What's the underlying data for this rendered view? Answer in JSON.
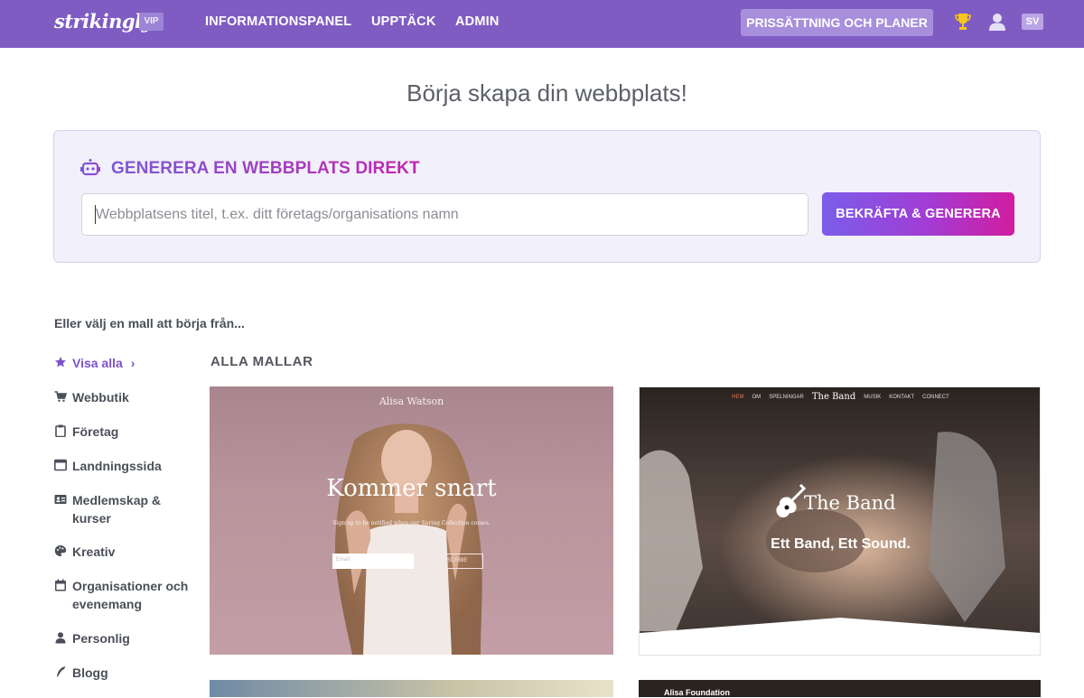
{
  "topbar": {
    "logo": "strikingly",
    "vip_badge": "VIP",
    "nav": [
      "INFORMATIONSPANEL",
      "UPPTÄCK",
      "ADMIN"
    ],
    "pricing_label": "PRISSÄTTNING OCH PLANER",
    "lang": "SV",
    "bg_color": "#7f5cc2"
  },
  "hero": {
    "title": "Börja skapa din webbplats!"
  },
  "generator": {
    "title": "GENERERA EN WEBBPLATS DIREKT",
    "input_placeholder": "Webbplatsens titel, t.ex. ditt företags/organisations namn",
    "input_value": "",
    "button_label": "BEKRÄFTA & GENERERA",
    "icon": "robot-icon"
  },
  "templates": {
    "intro": "Eller välj en mall att börja från...",
    "heading": "ALLA MALLAR",
    "categories": [
      {
        "label": "Visa alla",
        "icon": "star-icon",
        "active": true,
        "suffix": "›"
      },
      {
        "label": "Webbutik",
        "icon": "cart-icon"
      },
      {
        "label": "Företag",
        "icon": "clipboard-icon"
      },
      {
        "label": "Landningssida",
        "icon": "window-icon"
      },
      {
        "label": "Medlemskap & kurser",
        "icon": "id-card-icon"
      },
      {
        "label": "Kreativ",
        "icon": "palette-icon"
      },
      {
        "label": "Organisationer och evenemang",
        "icon": "calendar-icon"
      },
      {
        "label": "Personlig",
        "icon": "person-icon"
      },
      {
        "label": "Blogg",
        "icon": "quill-icon"
      }
    ],
    "cards": [
      {
        "brand": "Alisa Watson",
        "headline": "Kommer snart",
        "subtext": "Sign up to be notified when our Spring Collection comes.",
        "field_placeholder": "Email",
        "button": "SUBSCRIBE"
      },
      {
        "nav": [
          "HEM",
          "OM",
          "SPELNINGAR",
          "MUSIK",
          "KONTAKT",
          "CONNECT"
        ],
        "logo": "The Band",
        "tagline": "Ett Band, Ett Sound."
      },
      {
        "title": ""
      },
      {
        "title": "Alisa Foundation"
      }
    ]
  }
}
